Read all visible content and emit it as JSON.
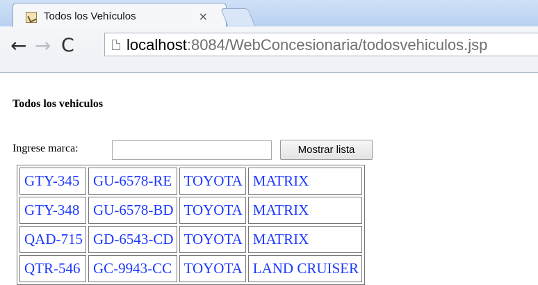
{
  "browser": {
    "tab_title": "Todos los Vehículos",
    "close_symbol": "×",
    "url_host": "localhost",
    "url_rest": ":8084/WebConcesionaria/todosvehiculos.jsp",
    "icons": {
      "favicon": "site-favicon-icon",
      "back": "back-arrow-icon",
      "forward": "forward-arrow-icon",
      "reload": "reload-icon",
      "page": "page-icon"
    }
  },
  "page": {
    "title": "Todos los vehiculos",
    "search_label": "Ingrese marca:",
    "search_value": "",
    "show_button": "Mostrar lista",
    "link_color": "#1d39ff",
    "rows": [
      [
        "GTY-345",
        "GU-6578-RE",
        "TOYOTA",
        "MATRIX"
      ],
      [
        "GTY-348",
        "GU-6578-BD",
        "TOYOTA",
        "MATRIX"
      ],
      [
        "QAD-715",
        "GD-6543-CD",
        "TOYOTA",
        "MATRIX"
      ],
      [
        "QTR-546",
        "GC-9943-CC",
        "TOYOTA",
        "LAND CRUISER"
      ]
    ]
  }
}
